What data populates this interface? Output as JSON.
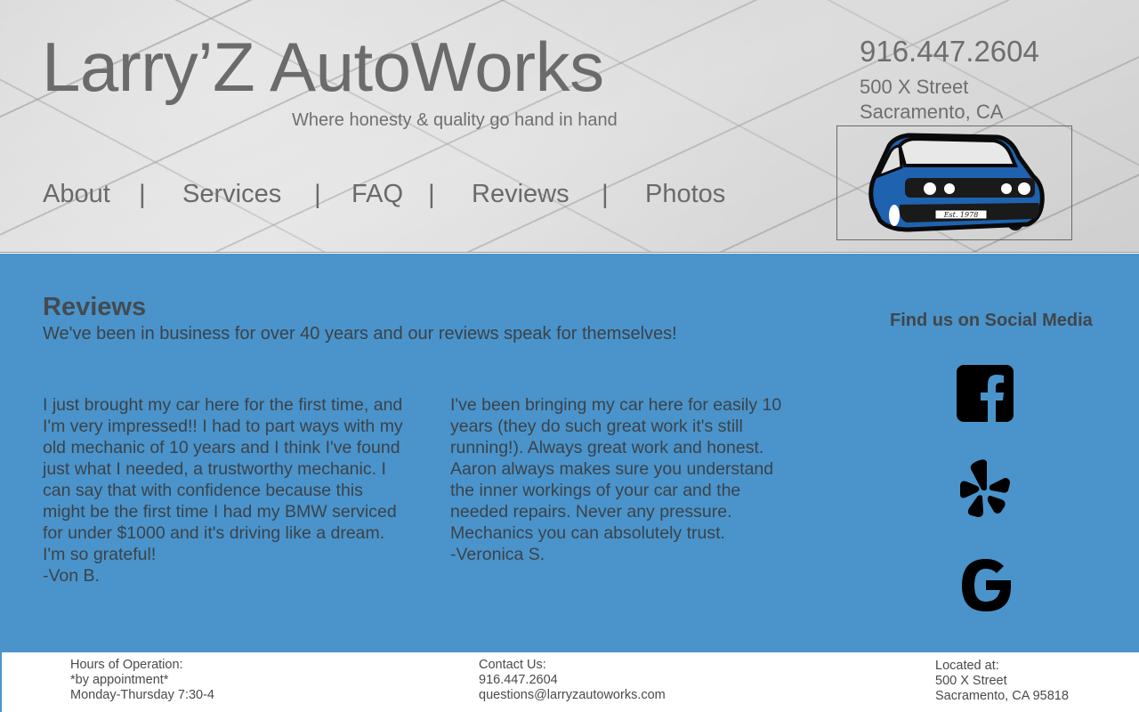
{
  "header": {
    "brand": "Larry’Z AutoWorks",
    "tagline": "Where honesty & quality go hand in hand",
    "phone": "916.447.2604",
    "address_line1": "500 X Street",
    "address_line2": "Sacramento, CA",
    "logo_badge": "Est. 1978",
    "nav": [
      {
        "label": "About"
      },
      {
        "label": "Services"
      },
      {
        "label": "FAQ"
      },
      {
        "label": "Reviews"
      },
      {
        "label": "Photos"
      }
    ],
    "nav_separator": "|"
  },
  "main": {
    "title": "Reviews",
    "intro": "We've been in business for over 40 years and our reviews speak for themselves!",
    "reviews": [
      {
        "text": "I just brought my car here for the first time, and I'm very impressed!! I had to part ways with my old mechanic of 10 years and I think I've found just what I needed, a trustworthy mechanic. I can say that with confidence because this might be the first time I had my BMW serviced for under $1000 and it's driving like a dream. I'm so grateful!",
        "author": "-Von B."
      },
      {
        "text": "I've been bringing my car here for easily 10 years (they do such great work it's still running!). Always great work and honest. Aaron always makes sure you understand the inner workings of your car and the needed repairs. Never any pressure. Mechanics you can absolutely trust.",
        "author": "-Veronica S."
      }
    ],
    "social": {
      "title": "Find us on Social Media",
      "icons": [
        "facebook-icon",
        "yelp-icon",
        "google-icon"
      ]
    }
  },
  "footer": {
    "hours": {
      "label": "Hours of Operation:",
      "line1": "*by appointment*",
      "line2": "Monday-Thursday 7:30-4"
    },
    "contact": {
      "label": "Contact Us:",
      "phone": "916.447.2604",
      "email": "questions@larryzautoworks.com"
    },
    "location": {
      "label": "Located at:",
      "line1": "500 X Street",
      "line2": "Sacramento, CA 95818"
    }
  },
  "colors": {
    "main_bg": "#4a94cb",
    "header_text": "#6b6b6b",
    "body_text": "#3b4249",
    "car_blue": "#1f63b0"
  }
}
